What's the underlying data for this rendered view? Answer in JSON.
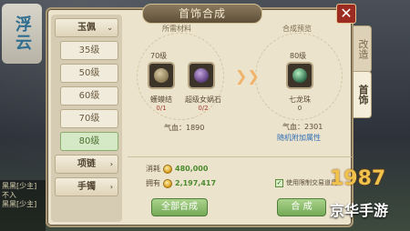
{
  "window": {
    "title": "首饰合成",
    "close_label": "✕"
  },
  "left_logo": {
    "text": "浮云"
  },
  "left_chat": {
    "lines": [
      "黑黑[少主]",
      "不入",
      "黑黑[少主]"
    ]
  },
  "sidebar": {
    "items": [
      {
        "label": "玉佩",
        "type": "cat",
        "chevron": "⌄"
      },
      {
        "label": "35级",
        "type": "sub"
      },
      {
        "label": "50级",
        "type": "sub"
      },
      {
        "label": "60级",
        "type": "sub"
      },
      {
        "label": "70级",
        "type": "sub"
      },
      {
        "label": "80级",
        "type": "sub",
        "active": true
      },
      {
        "label": "项链",
        "type": "cat",
        "chevron": "›"
      },
      {
        "label": "手镯",
        "type": "cat",
        "chevron": "›"
      }
    ]
  },
  "tabs": [
    {
      "label": "改造",
      "active": false
    },
    {
      "label": "首饰",
      "active": true
    }
  ],
  "materials": {
    "section_label": "所需材料",
    "level_label": "70级",
    "items": [
      {
        "name": "蠖蟆结",
        "count": "0/1"
      },
      {
        "name": "超级女娲石",
        "count": "0/2"
      }
    ],
    "stat": "气血：1890"
  },
  "preview": {
    "section_label": "合成预览",
    "level_label": "80级",
    "name": "七龙珠",
    "count": "0",
    "stat": "气血：2301",
    "extra": "随机附加属性"
  },
  "cost": {
    "consume_label": "消耗",
    "consume_value": "480,000",
    "own_label": "拥有",
    "own_value": "2,197,417"
  },
  "options": {
    "bound_label": "使用限制交易道具",
    "checked": "✓"
  },
  "buttons": {
    "all_merge": "全部合成",
    "merge": "合 成"
  },
  "watermark": {
    "line1": "1987",
    "line2": "京华手游"
  }
}
